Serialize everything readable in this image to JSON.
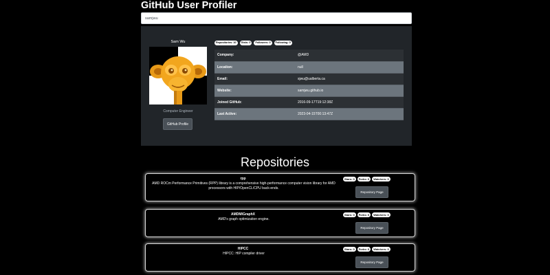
{
  "app": {
    "title": "GitHub User Profiler"
  },
  "search": {
    "value": "samjwu"
  },
  "profile": {
    "name": "Sam Wu",
    "bio": "Computer Engineer",
    "github_button": "GitHub Profile",
    "badges": [
      "Repositories: 10",
      "Gists: 0",
      "Followers: 0",
      "Following: 0"
    ],
    "details": [
      {
        "label": "Company:",
        "value": "@AMD"
      },
      {
        "label": "Location:",
        "value": "null"
      },
      {
        "label": "Email:",
        "value": "sjwu@ualberta.ca"
      },
      {
        "label": "Website:",
        "value": "samjwu.github.io"
      },
      {
        "label": "Joined GitHub:",
        "value": "2016-09-17T19:12:38Z"
      },
      {
        "label": "Last Active:",
        "value": "2023-04-15T00:13:47Z"
      }
    ]
  },
  "repositories": {
    "heading": "Repositories",
    "button_label": "Repository Page",
    "items": [
      {
        "name": "rpp",
        "description": "AMD ROCm Performance Primitives (RPP) library is a comprehensive high-performance computer vision library for AMD processors with HIP/OpenCL/CPU back-ends.",
        "stars": "Stars: 0",
        "forks": "Forks: 0",
        "watchers": "Watchers: 0"
      },
      {
        "name": "AMDMIGraphX",
        "description": "AMD's graph optimization engine.",
        "stars": "Stars: 0",
        "forks": "Forks: 0",
        "watchers": "Watchers: 0"
      },
      {
        "name": "HIPCC",
        "description": "HIPCC: HIP compiler driver",
        "stars": "Stars: 0",
        "forks": "Forks: 0",
        "watchers": "Watchers: 0"
      }
    ]
  },
  "colors": {
    "background": "#000000",
    "card": "#212529",
    "row_dark": "#2c3034",
    "row_light": "#6c757d",
    "button": "#495057",
    "avatar_accent": "#f0a020"
  },
  "icons": {
    "avatar": "orange-monkey-head-avatar"
  }
}
